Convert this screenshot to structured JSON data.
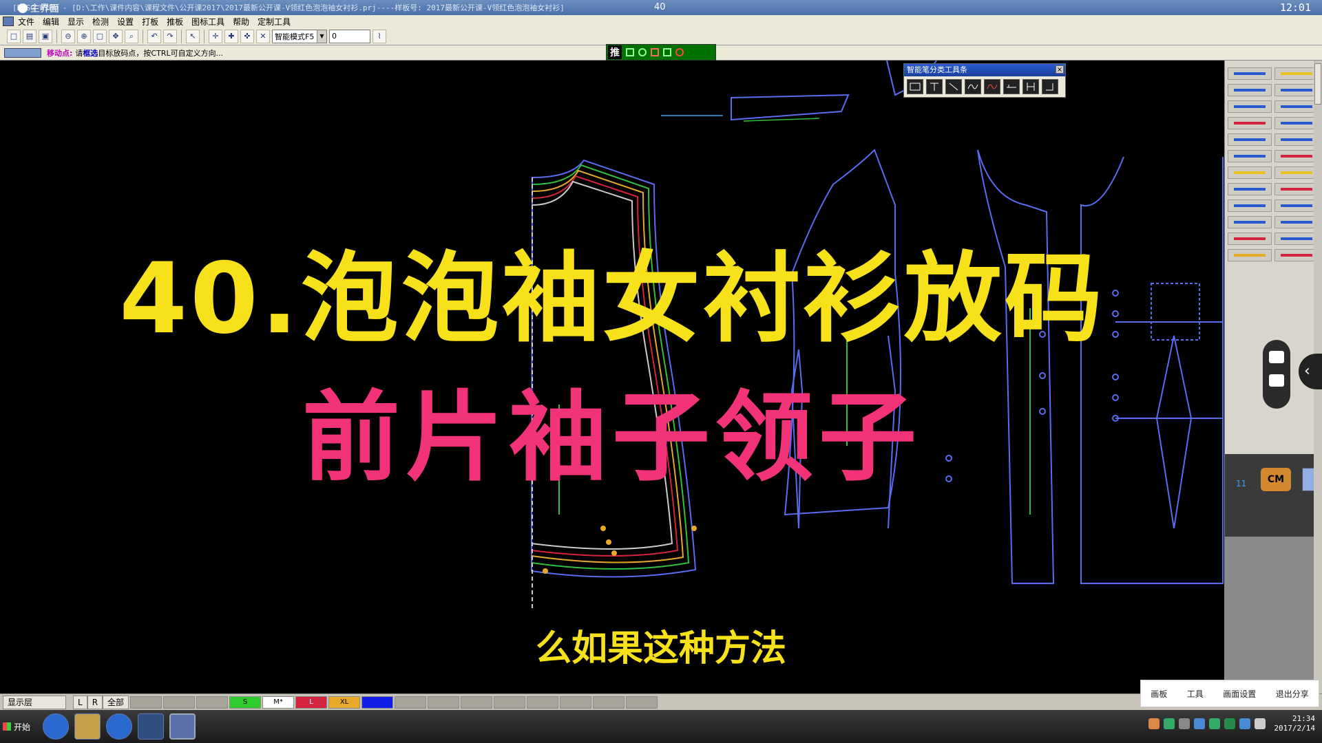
{
  "window": {
    "title": "[DLSG WIBU - [D:\\工作\\课件内容\\课程文件\\公开课2017\\2017最新公开课-V领红色泡泡袖女衬衫.prj----样板号: 2017最新公开课-V领红色泡泡袖女衬衫]",
    "home_label": "主界面",
    "center_label": "40",
    "clock": "12:01"
  },
  "menu": {
    "items": [
      "文件",
      "编辑",
      "显示",
      "检测",
      "设置",
      "打板",
      "推板",
      "图标工具",
      "帮助",
      "定制工具"
    ]
  },
  "toolbar": {
    "mode_select": "智能模式F5",
    "value_input": "0"
  },
  "status": {
    "label": "移动点:",
    "message_prefix": "请",
    "message_highlight": "框选",
    "message_suffix": "目标放码点，按CTRL可自定义方向..."
  },
  "push_bar": {
    "label": "推"
  },
  "smart_pen": {
    "title": "智能笔分类工具条",
    "close": "×",
    "tools": [
      "rect-tool",
      "text-tool",
      "line-tool",
      "curve-tool",
      "wave-tool",
      "align-tool",
      "height-tool",
      "corner-tool"
    ]
  },
  "overlay": {
    "title": "40.泡泡袖女衬衫放码",
    "subtitle": "前片袖子领子",
    "caption": "么如果这种方法"
  },
  "right_panel": {
    "num": "11",
    "cm_label": "CM"
  },
  "layer_bar": {
    "display_layer": "显示层",
    "L": "L",
    "R": "R",
    "all": "全部",
    "sizes": [
      {
        "label": "S",
        "color": "#2ecc2e"
      },
      {
        "label": "M*",
        "color": "#ffffff"
      },
      {
        "label": "L",
        "color": "#d4243f"
      },
      {
        "label": "XL",
        "color": "#e8a92a"
      },
      {
        "label": "",
        "color": "#1020e8"
      }
    ]
  },
  "share": {
    "items": [
      "画板",
      "工具",
      "画面设置",
      "退出分享"
    ]
  },
  "taskbar": {
    "start": "开始",
    "time": "21:34",
    "date": "2017/2/14"
  },
  "colors": {
    "title_yellow": "#f7e11b",
    "subtitle_pink": "#f2337a",
    "pattern_line": "#5a6cf0"
  }
}
